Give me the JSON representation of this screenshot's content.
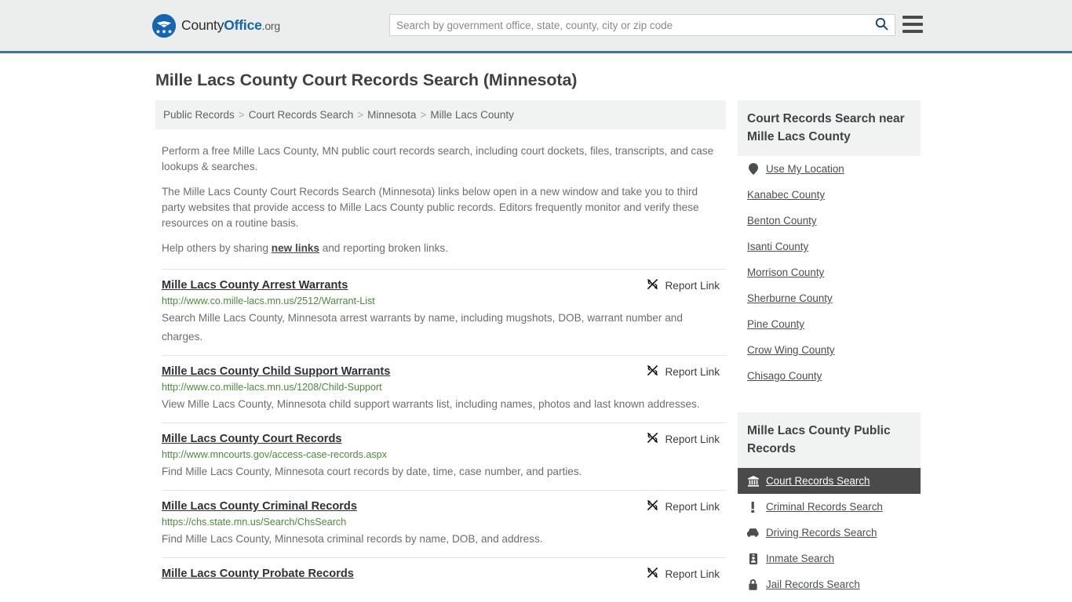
{
  "header": {
    "logo": {
      "part1": "County",
      "part2": "Office",
      "part3": ".org",
      "icon": "eagle-shield-logo"
    },
    "search": {
      "placeholder": "Search by government office, state, county, city or zip code",
      "value": "",
      "button_icon": "search-icon"
    },
    "menu_icon": "hamburger-menu-icon",
    "accent_color": "#3a72a4",
    "background_color": "#eceded"
  },
  "page_title": "Mille Lacs County Court Records Search (Minnesota)",
  "breadcrumb": [
    "Public Records",
    "Court Records Search",
    "Minnesota",
    "Mille Lacs County"
  ],
  "breadcrumb_separator": ">",
  "intro": {
    "p1": "Perform a free Mille Lacs County, MN public court records search, including court dockets, files, transcripts, and case lookups & searches.",
    "p2": "The Mille Lacs County Court Records Search (Minnesota) links below open in a new window and take you to third party websites that provide access to Mille Lacs County public records. Editors frequently monitor and verify these resources on a routine basis.",
    "p3_before": "Help others by sharing ",
    "p3_link": "new links",
    "p3_after": " and reporting broken links."
  },
  "report_link_label": "Report Link",
  "report_link_icon": "broken-link-icon",
  "results": [
    {
      "title": "Mille Lacs County Arrest Warrants",
      "url": "http://www.co.mille-lacs.mn.us/2512/Warrant-List",
      "description": "Search Mille Lacs County, Minnesota arrest warrants by name, including mugshots, DOB, warrant number and charges."
    },
    {
      "title": "Mille Lacs County Child Support Warrants",
      "url": "http://www.co.mille-lacs.mn.us/1208/Child-Support",
      "description": "View Mille Lacs County, Minnesota child support warrants list, including names, photos and last known addresses."
    },
    {
      "title": "Mille Lacs County Court Records",
      "url": "http://www.mncourts.gov/access-case-records.aspx",
      "description": "Find Mille Lacs County, Minnesota court records by date, time, case number, and parties."
    },
    {
      "title": "Mille Lacs County Criminal Records",
      "url": "https://chs.state.mn.us/Search/ChsSearch",
      "description": "Find Mille Lacs County, Minnesota criminal records by name, DOB, and address."
    },
    {
      "title": "Mille Lacs County Probate Records",
      "url": "",
      "description": ""
    }
  ],
  "sidebar": {
    "nearby": {
      "heading": "Court Records Search near Mille Lacs County",
      "items": [
        {
          "label": "Use My Location",
          "icon": "map-pin-icon"
        },
        {
          "label": "Kanabec County",
          "icon": ""
        },
        {
          "label": "Benton County",
          "icon": ""
        },
        {
          "label": "Isanti County",
          "icon": ""
        },
        {
          "label": "Morrison County",
          "icon": ""
        },
        {
          "label": "Sherburne County",
          "icon": ""
        },
        {
          "label": "Pine County",
          "icon": ""
        },
        {
          "label": "Crow Wing County",
          "icon": ""
        },
        {
          "label": "Chisago County",
          "icon": ""
        }
      ]
    },
    "public_records": {
      "heading": "Mille Lacs County Public Records",
      "active_background": "#4a4a4a",
      "items": [
        {
          "label": "Court Records Search",
          "icon": "bank-icon",
          "active": true
        },
        {
          "label": "Criminal Records Search",
          "icon": "exclamation-icon",
          "active": false
        },
        {
          "label": "Driving Records Search",
          "icon": "car-icon",
          "active": false
        },
        {
          "label": "Inmate Search",
          "icon": "id-badge-icon",
          "active": false
        },
        {
          "label": "Jail Records Search",
          "icon": "lock-icon",
          "active": false
        }
      ]
    }
  }
}
